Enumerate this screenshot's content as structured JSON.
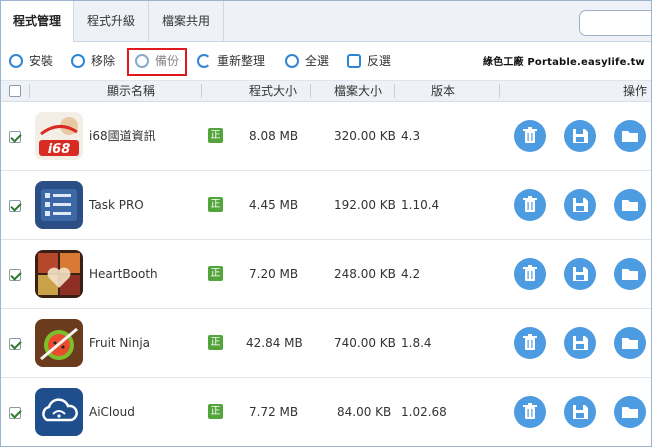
{
  "tabs": [
    {
      "label": "程式管理",
      "active": true
    },
    {
      "label": "程式升級",
      "active": false
    },
    {
      "label": "檔案共用",
      "active": false
    }
  ],
  "toolbar": {
    "install": "安裝",
    "remove": "移除",
    "backup": "備份",
    "reorganize": "重新整理",
    "select_all": "全選",
    "invert": "反選"
  },
  "watermark": "綠色工廠 Portable.easylife.tw",
  "columns": {
    "name": "顯示名稱",
    "app_size": "程式大小",
    "file_size": "檔案大小",
    "version": "版本",
    "action": "操作"
  },
  "badge_label": "正",
  "apps": [
    {
      "name": "i68國道資訊",
      "app_size": "8.08 MB",
      "file_size": "320.00 KB",
      "version": "4.3",
      "checked": true,
      "icon": "i68-icon"
    },
    {
      "name": "Task PRO",
      "app_size": "4.45 MB",
      "file_size": "192.00 KB",
      "version": "1.10.4",
      "checked": true,
      "icon": "task-pro-icon"
    },
    {
      "name": "HeartBooth",
      "app_size": "7.20 MB",
      "file_size": "248.00 KB",
      "version": "4.2",
      "checked": true,
      "icon": "heartbooth-icon"
    },
    {
      "name": "Fruit Ninja",
      "app_size": "42.84 MB",
      "file_size": "740.00 KB",
      "version": "1.8.4",
      "checked": true,
      "icon": "fruit-ninja-icon"
    },
    {
      "name": "AiCloud",
      "app_size": "7.72 MB",
      "file_size": "84.00 KB",
      "version": "1.02.68",
      "checked": true,
      "icon": "aicloud-icon"
    }
  ],
  "colors": {
    "accent": "#2f86d6",
    "action_button": "#4d9be0",
    "badge": "#53a53b",
    "highlight": "#e0191c"
  }
}
